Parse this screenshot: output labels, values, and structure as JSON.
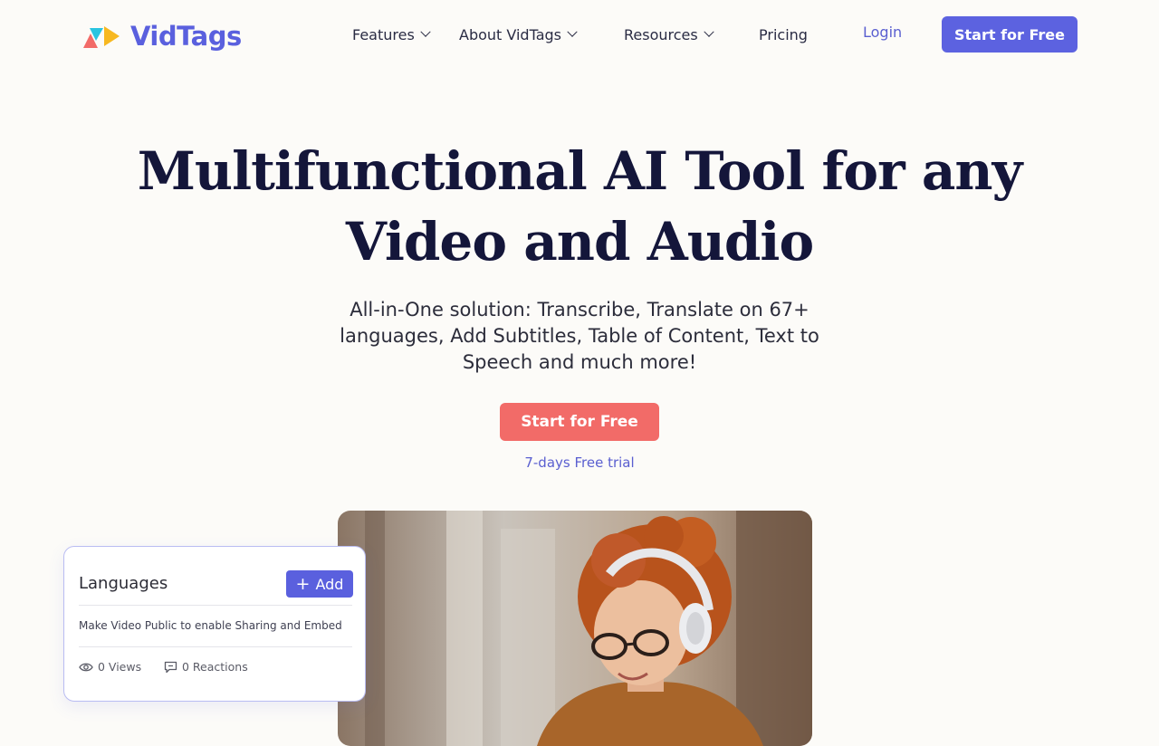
{
  "header": {
    "brand": "VidTags",
    "nav": [
      {
        "label": "Features",
        "has_dropdown": true
      },
      {
        "label": "About VidTags",
        "has_dropdown": true
      },
      {
        "label": "Resources",
        "has_dropdown": true
      },
      {
        "label": "Pricing",
        "has_dropdown": false
      }
    ],
    "login_label": "Login",
    "cta_label": "Start for Free"
  },
  "hero": {
    "title": "Multifunctional AI Tool for any Video and Audio",
    "subtitle": "All-in-One solution: Transcribe, Translate on 67+ languages, Add Subtitles, Table of Content, Text to Speech and much more!",
    "cta_label": "Start for Free",
    "trial_note": "7-days Free trial"
  },
  "languages_card": {
    "title": "Languages",
    "add_label": "Add",
    "notice": "Make Video Public to enable Sharing and Embed",
    "views": "0 Views",
    "reactions": "0 Reactions"
  },
  "colors": {
    "brand": "#5a60de",
    "cta": "#f26b68",
    "background": "#fcfbf8",
    "heading": "#14163a"
  },
  "icons": [
    "logo-triangles-icon",
    "chevron-down-icon",
    "plus-icon",
    "eye-icon",
    "comment-icon"
  ]
}
